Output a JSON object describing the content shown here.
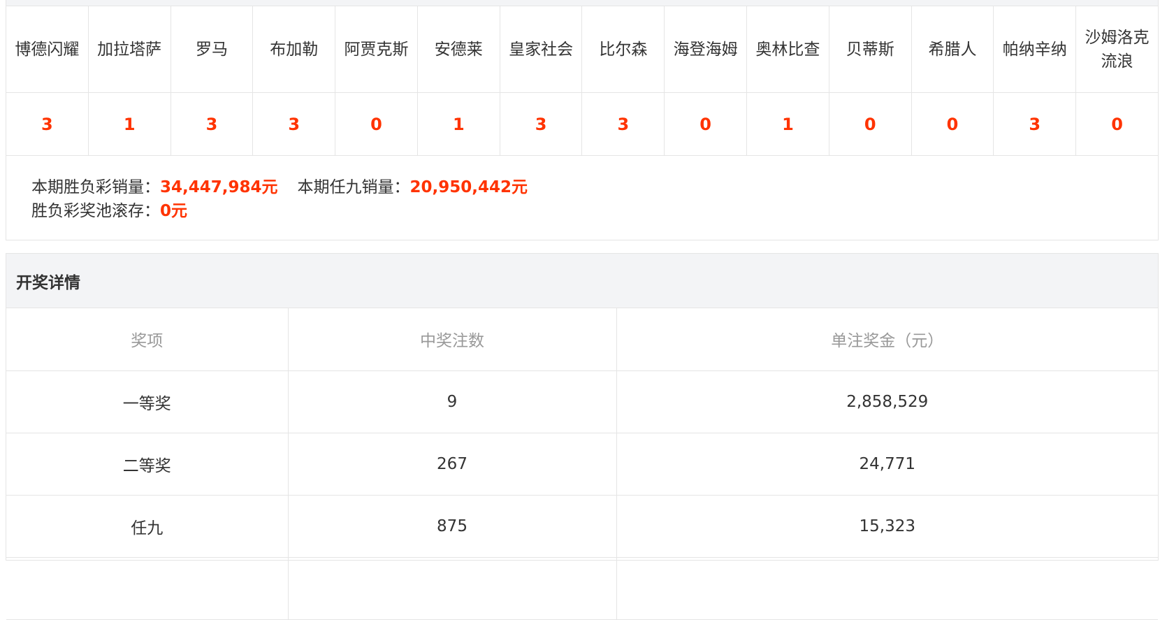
{
  "matches": [
    {
      "team": "博德闪耀",
      "result": "3"
    },
    {
      "team": "加拉塔萨",
      "result": "1"
    },
    {
      "team": "罗马",
      "result": "3"
    },
    {
      "team": "布加勒",
      "result": "3"
    },
    {
      "team": "阿贾克斯",
      "result": "0"
    },
    {
      "team": "安德莱",
      "result": "1"
    },
    {
      "team": "皇家社会",
      "result": "3"
    },
    {
      "team": "比尔森",
      "result": "3"
    },
    {
      "team": "海登海姆",
      "result": "0"
    },
    {
      "team": "奥林比查",
      "result": "1"
    },
    {
      "team": "贝蒂斯",
      "result": "0"
    },
    {
      "team": "希腊人",
      "result": "0"
    },
    {
      "team": "帕纳辛纳",
      "result": "3"
    },
    {
      "team": "沙姆洛克流浪",
      "result": "0"
    }
  ],
  "sales": {
    "sfc_label": "本期胜负彩销量：",
    "sfc_value": "34,447,984元",
    "r9_label": "本期任九销量：",
    "r9_value": "20,950,442元",
    "pool_label": "胜负彩奖池滚存：",
    "pool_value": "0元"
  },
  "details": {
    "title": "开奖详情",
    "headers": [
      "奖项",
      "中奖注数",
      "单注奖金（元）"
    ],
    "rows": [
      [
        "一等奖",
        "9",
        "2,858,529"
      ],
      [
        "二等奖",
        "267",
        "24,771"
      ],
      [
        "任九",
        "875",
        "15,323"
      ]
    ]
  },
  "colors": {
    "accent": "#ff3300",
    "border": "#e5e5e5",
    "header_bg": "#f3f4f6",
    "muted_text": "#999999"
  }
}
